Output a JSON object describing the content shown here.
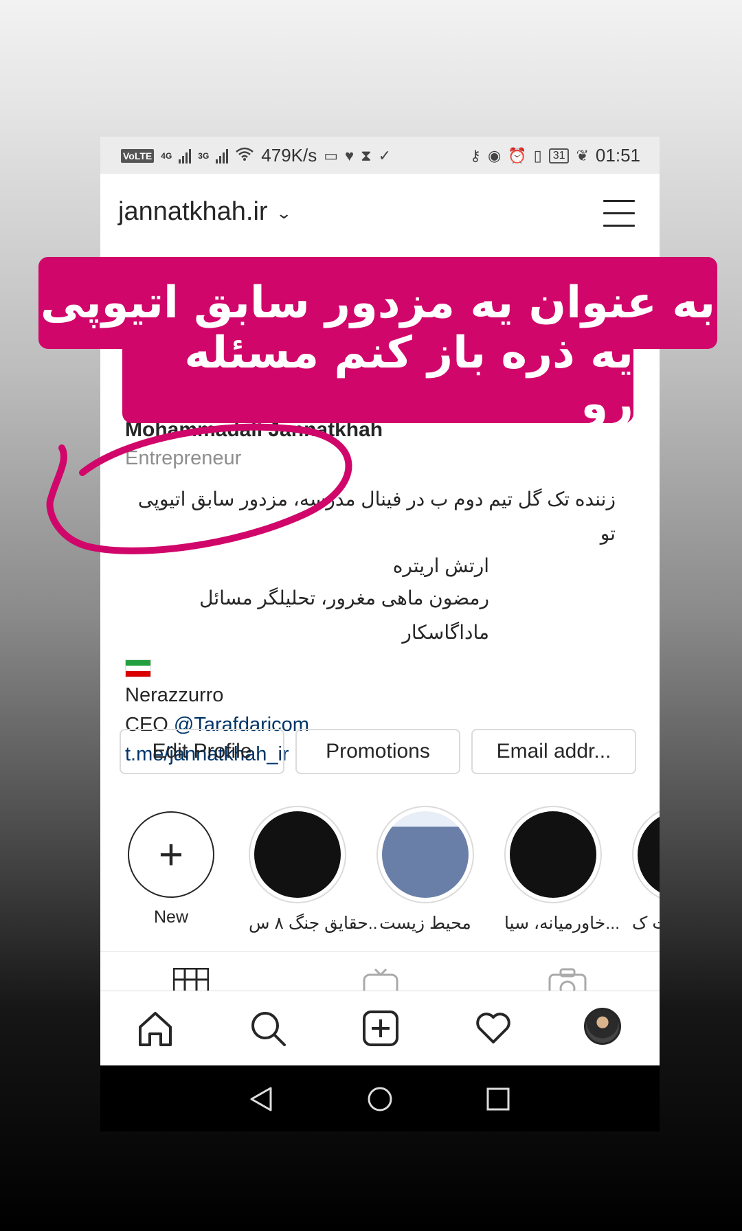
{
  "statusbar": {
    "volte": "VoLTE",
    "sim1_net": "4G",
    "sim2_net": "3G",
    "speed": "479K/s",
    "battery": "31",
    "time": "01:51"
  },
  "header": {
    "username": "jannatkhah.ir"
  },
  "profile": {
    "name": "Mohammadali Jannatkhah",
    "category": "Entrepreneur",
    "bio_line1": "زننده تک گل تیم دوم ب در فینال مدرسه، مزدور سابق اتیوپی تو",
    "bio_line2": "ارتش اریتره",
    "bio_line3": "رمضون ماهی مغرور، تحلیلگر مسائل ماداگاسکار",
    "bio_line4": "Nerazzurro",
    "bio_ceo_prefix": "CEO ",
    "bio_mention": "@Tarafdaricom",
    "bio_link": "t.me/jannatkhah_ir"
  },
  "buttons": {
    "edit_profile": "Edit Profile",
    "promotions": "Promotions",
    "email": "Email addr..."
  },
  "stories": [
    {
      "label": "New"
    },
    {
      "label": "حقایق جنگ ۸ س.."
    },
    {
      "label": "محیط زیست"
    },
    {
      "label": "خاورمیانه، سیا..."
    },
    {
      "label": "ت ک..."
    }
  ],
  "overlay": {
    "line1": "به عنوان یه مزدور سابق اتیوپی",
    "line2": "یه ذره باز کنم مسئله رو"
  },
  "colors": {
    "accent": "#d1066a",
    "link": "#003569",
    "muted": "#8e8e8e"
  }
}
